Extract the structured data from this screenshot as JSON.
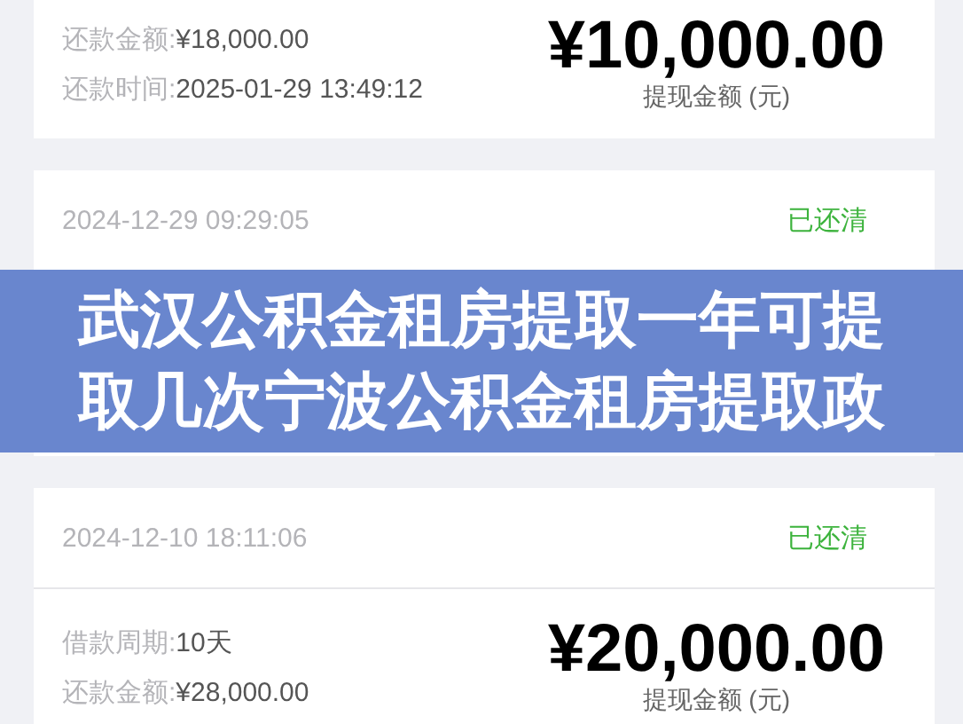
{
  "records": [
    {
      "rows": [
        {
          "label": "还款金额:",
          "value": "¥18,000.00"
        },
        {
          "label": "还款时间:",
          "value": "2025-01-29 13:49:12"
        }
      ],
      "amount": "¥10,000.00",
      "amount_caption": "提现金额 (元)"
    },
    {
      "header": {
        "time": "2024-12-29 09:29:05",
        "status": "已还清",
        "settled": true
      }
    },
    {
      "header": {
        "time": "2024-12-10 18:11:06",
        "status": "已还清",
        "settled": true
      },
      "rows": [
        {
          "label": "借款周期:",
          "value": "10天"
        },
        {
          "label": "还款金额:",
          "value": "¥28,000.00"
        }
      ],
      "amount": "¥20,000.00",
      "amount_caption": "提现金额 (元)"
    }
  ],
  "banner": {
    "title": "武汉公积金租房提取一年可提取几次宁波公积金租房提取政"
  }
}
